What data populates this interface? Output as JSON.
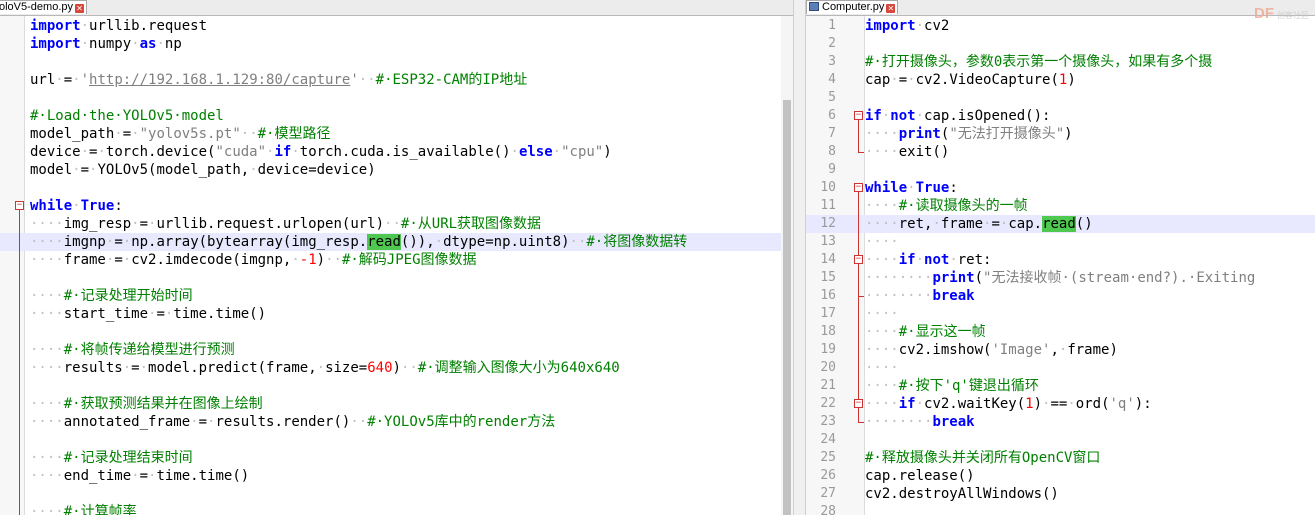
{
  "left_editor": {
    "tab": {
      "title": "oloV5-demo.py"
    },
    "lines": [
      {
        "num": "",
        "segs": [
          [
            "k",
            "import"
          ],
          [
            "ws",
            "·"
          ],
          [
            "t",
            "urllib.request"
          ]
        ]
      },
      {
        "num": "",
        "segs": [
          [
            "k",
            "import"
          ],
          [
            "ws",
            "·"
          ],
          [
            "t",
            "numpy"
          ],
          [
            "ws",
            "·"
          ],
          [
            "k",
            "as"
          ],
          [
            "ws",
            "·"
          ],
          [
            "t",
            "np"
          ]
        ]
      },
      {
        "num": "",
        "segs": []
      },
      {
        "num": "",
        "segs": [
          [
            "t",
            "url"
          ],
          [
            "ws",
            "·"
          ],
          [
            "t",
            "="
          ],
          [
            "ws",
            "·"
          ],
          [
            "s",
            "'"
          ],
          [
            "u",
            "http://192.168.1.129:80/capture"
          ],
          [
            "s",
            "'"
          ],
          [
            "ws",
            "··"
          ],
          [
            "c",
            "#·ESP32-CAM的IP地址"
          ]
        ]
      },
      {
        "num": "",
        "segs": []
      },
      {
        "num": "",
        "segs": [
          [
            "c",
            "#·Load·the·YOLOv5·model"
          ]
        ]
      },
      {
        "num": "",
        "segs": [
          [
            "t",
            "model_path"
          ],
          [
            "ws",
            "·"
          ],
          [
            "t",
            "="
          ],
          [
            "ws",
            "·"
          ],
          [
            "s",
            "\"yolov5s.pt\""
          ],
          [
            "ws",
            "··"
          ],
          [
            "c",
            "#·模型路径"
          ]
        ]
      },
      {
        "num": "",
        "segs": [
          [
            "t",
            "device"
          ],
          [
            "ws",
            "·"
          ],
          [
            "t",
            "="
          ],
          [
            "ws",
            "·"
          ],
          [
            "t",
            "torch.device("
          ],
          [
            "s",
            "\"cuda\""
          ],
          [
            "ws",
            "·"
          ],
          [
            "k",
            "if"
          ],
          [
            "ws",
            "·"
          ],
          [
            "t",
            "torch.cuda.is_available()"
          ],
          [
            "ws",
            "·"
          ],
          [
            "k",
            "else"
          ],
          [
            "ws",
            "·"
          ],
          [
            "s",
            "\"cpu\""
          ],
          [
            "t",
            ")"
          ]
        ]
      },
      {
        "num": "",
        "segs": [
          [
            "t",
            "model"
          ],
          [
            "ws",
            "·"
          ],
          [
            "t",
            "="
          ],
          [
            "ws",
            "·"
          ],
          [
            "t",
            "YOLOv5(model_path,"
          ],
          [
            "ws",
            "·"
          ],
          [
            "t",
            "device=device)"
          ]
        ]
      },
      {
        "num": "",
        "segs": []
      },
      {
        "num": "",
        "segs": [
          [
            "k",
            "while"
          ],
          [
            "ws",
            "·"
          ],
          [
            "k",
            "True"
          ],
          [
            "t",
            ":"
          ]
        ]
      },
      {
        "num": "",
        "segs": [
          [
            "ws",
            "····"
          ],
          [
            "t",
            "img_resp"
          ],
          [
            "ws",
            "·"
          ],
          [
            "t",
            "="
          ],
          [
            "ws",
            "·"
          ],
          [
            "t",
            "urllib.request.urlopen(url)"
          ],
          [
            "ws",
            "··"
          ],
          [
            "c",
            "#·从URL获取图像数据"
          ]
        ]
      },
      {
        "num": "",
        "hl": true,
        "segs": [
          [
            "ws",
            "····"
          ],
          [
            "t",
            "imgnp"
          ],
          [
            "ws",
            "·"
          ],
          [
            "t",
            "="
          ],
          [
            "ws",
            "·"
          ],
          [
            "t",
            "np.array(bytearray(img_resp."
          ],
          [
            "m",
            "read"
          ],
          [
            "t",
            "()),"
          ],
          [
            "ws",
            "·"
          ],
          [
            "t",
            "dtype=np.uint8)"
          ],
          [
            "ws",
            "··"
          ],
          [
            "c",
            "#·将图像数据转"
          ]
        ]
      },
      {
        "num": "",
        "segs": [
          [
            "ws",
            "····"
          ],
          [
            "t",
            "frame"
          ],
          [
            "ws",
            "·"
          ],
          [
            "t",
            "="
          ],
          [
            "ws",
            "·"
          ],
          [
            "t",
            "cv2.imdecode(imgnp,"
          ],
          [
            "ws",
            "·"
          ],
          [
            "n",
            "-1"
          ],
          [
            "t",
            ")"
          ],
          [
            "ws",
            "··"
          ],
          [
            "c",
            "#·解码JPEG图像数据"
          ]
        ]
      },
      {
        "num": "",
        "segs": []
      },
      {
        "num": "",
        "segs": [
          [
            "ws",
            "····"
          ],
          [
            "c",
            "#·记录处理开始时间"
          ]
        ]
      },
      {
        "num": "",
        "segs": [
          [
            "ws",
            "····"
          ],
          [
            "t",
            "start_time"
          ],
          [
            "ws",
            "·"
          ],
          [
            "t",
            "="
          ],
          [
            "ws",
            "·"
          ],
          [
            "t",
            "time.time()"
          ]
        ]
      },
      {
        "num": "",
        "segs": []
      },
      {
        "num": "",
        "segs": [
          [
            "ws",
            "····"
          ],
          [
            "c",
            "#·将帧传递给模型进行预测"
          ]
        ]
      },
      {
        "num": "",
        "segs": [
          [
            "ws",
            "····"
          ],
          [
            "t",
            "results"
          ],
          [
            "ws",
            "·"
          ],
          [
            "t",
            "="
          ],
          [
            "ws",
            "·"
          ],
          [
            "t",
            "model.predict(frame,"
          ],
          [
            "ws",
            "·"
          ],
          [
            "t",
            "size="
          ],
          [
            "n",
            "640"
          ],
          [
            "t",
            ")"
          ],
          [
            "ws",
            "··"
          ],
          [
            "c",
            "#·调整输入图像大小为640x640"
          ]
        ]
      },
      {
        "num": "",
        "segs": []
      },
      {
        "num": "",
        "segs": [
          [
            "ws",
            "····"
          ],
          [
            "c",
            "#·获取预测结果并在图像上绘制"
          ]
        ]
      },
      {
        "num": "",
        "segs": [
          [
            "ws",
            "····"
          ],
          [
            "t",
            "annotated_frame"
          ],
          [
            "ws",
            "·"
          ],
          [
            "t",
            "="
          ],
          [
            "ws",
            "·"
          ],
          [
            "t",
            "results.render()"
          ],
          [
            "ws",
            "··"
          ],
          [
            "c",
            "#·YOLOv5库中的render方法"
          ]
        ]
      },
      {
        "num": "",
        "segs": []
      },
      {
        "num": "",
        "segs": [
          [
            "ws",
            "····"
          ],
          [
            "c",
            "#·记录处理结束时间"
          ]
        ]
      },
      {
        "num": "",
        "segs": [
          [
            "ws",
            "····"
          ],
          [
            "t",
            "end_time"
          ],
          [
            "ws",
            "·"
          ],
          [
            "t",
            "="
          ],
          [
            "ws",
            "·"
          ],
          [
            "t",
            "time.time()"
          ]
        ]
      },
      {
        "num": "",
        "segs": []
      },
      {
        "num": "",
        "segs": [
          [
            "ws",
            "····"
          ],
          [
            "c",
            "#·计算帧率"
          ]
        ]
      }
    ]
  },
  "right_editor": {
    "tab": {
      "title": "Computer.py"
    },
    "lines": [
      {
        "num": "1",
        "segs": [
          [
            "k",
            "import"
          ],
          [
            "ws",
            "·"
          ],
          [
            "t",
            "cv2"
          ]
        ]
      },
      {
        "num": "2",
        "segs": []
      },
      {
        "num": "3",
        "segs": [
          [
            "c",
            "#·打开摄像头，参数0表示第一个摄像头，如果有多个摄"
          ]
        ]
      },
      {
        "num": "4",
        "segs": [
          [
            "t",
            "cap"
          ],
          [
            "ws",
            "·"
          ],
          [
            "t",
            "="
          ],
          [
            "ws",
            "·"
          ],
          [
            "t",
            "cv2.VideoCapture("
          ],
          [
            "n",
            "1"
          ],
          [
            "t",
            ")"
          ]
        ]
      },
      {
        "num": "5",
        "segs": []
      },
      {
        "num": "6",
        "segs": [
          [
            "k",
            "if"
          ],
          [
            "ws",
            "·"
          ],
          [
            "k",
            "not"
          ],
          [
            "ws",
            "·"
          ],
          [
            "t",
            "cap.isOpened():"
          ]
        ]
      },
      {
        "num": "7",
        "segs": [
          [
            "ws",
            "····"
          ],
          [
            "k",
            "print"
          ],
          [
            "t",
            "("
          ],
          [
            "s",
            "\"无法打开摄像头\""
          ],
          [
            "t",
            ")"
          ]
        ]
      },
      {
        "num": "8",
        "segs": [
          [
            "ws",
            "····"
          ],
          [
            "t",
            "exit()"
          ]
        ]
      },
      {
        "num": "9",
        "segs": []
      },
      {
        "num": "10",
        "segs": [
          [
            "k",
            "while"
          ],
          [
            "ws",
            "·"
          ],
          [
            "k",
            "True"
          ],
          [
            "t",
            ":"
          ]
        ]
      },
      {
        "num": "11",
        "segs": [
          [
            "ws",
            "····"
          ],
          [
            "c",
            "#·读取摄像头的一帧"
          ]
        ]
      },
      {
        "num": "12",
        "hl": true,
        "segs": [
          [
            "ws",
            "····"
          ],
          [
            "t",
            "ret,"
          ],
          [
            "ws",
            "·"
          ],
          [
            "t",
            "frame"
          ],
          [
            "ws",
            "·"
          ],
          [
            "t",
            "="
          ],
          [
            "ws",
            "·"
          ],
          [
            "t",
            "cap."
          ],
          [
            "m",
            "read"
          ],
          [
            "t",
            "()"
          ]
        ]
      },
      {
        "num": "13",
        "segs": [
          [
            "ws",
            "····"
          ]
        ]
      },
      {
        "num": "14",
        "segs": [
          [
            "ws",
            "····"
          ],
          [
            "k",
            "if"
          ],
          [
            "ws",
            "·"
          ],
          [
            "k",
            "not"
          ],
          [
            "ws",
            "·"
          ],
          [
            "t",
            "ret:"
          ]
        ]
      },
      {
        "num": "15",
        "segs": [
          [
            "ws",
            "········"
          ],
          [
            "k",
            "print"
          ],
          [
            "t",
            "("
          ],
          [
            "s",
            "\"无法接收帧·(stream·end?).·Exiting"
          ]
        ]
      },
      {
        "num": "16",
        "segs": [
          [
            "ws",
            "········"
          ],
          [
            "k",
            "break"
          ]
        ]
      },
      {
        "num": "17",
        "segs": [
          [
            "ws",
            "····"
          ]
        ]
      },
      {
        "num": "18",
        "segs": [
          [
            "ws",
            "····"
          ],
          [
            "c",
            "#·显示这一帧"
          ]
        ]
      },
      {
        "num": "19",
        "segs": [
          [
            "ws",
            "····"
          ],
          [
            "t",
            "cv2.imshow("
          ],
          [
            "s",
            "'Image'"
          ],
          [
            "t",
            ","
          ],
          [
            "ws",
            "·"
          ],
          [
            "t",
            "frame)"
          ]
        ]
      },
      {
        "num": "20",
        "segs": [
          [
            "ws",
            "····"
          ]
        ]
      },
      {
        "num": "21",
        "segs": [
          [
            "ws",
            "····"
          ],
          [
            "c",
            "#·按下'q'键退出循环"
          ]
        ]
      },
      {
        "num": "22",
        "segs": [
          [
            "ws",
            "····"
          ],
          [
            "k",
            "if"
          ],
          [
            "ws",
            "·"
          ],
          [
            "t",
            "cv2.waitKey("
          ],
          [
            "n",
            "1"
          ],
          [
            "t",
            ")"
          ],
          [
            "ws",
            "·"
          ],
          [
            "t",
            "=="
          ],
          [
            "ws",
            "·"
          ],
          [
            "t",
            "ord("
          ],
          [
            "s",
            "'q'"
          ],
          [
            "t",
            "):"
          ]
        ]
      },
      {
        "num": "23",
        "segs": [
          [
            "ws",
            "········"
          ],
          [
            "k",
            "break"
          ]
        ]
      },
      {
        "num": "24",
        "segs": []
      },
      {
        "num": "25",
        "segs": [
          [
            "c",
            "#·释放摄像头并关闭所有OpenCV窗口"
          ]
        ]
      },
      {
        "num": "26",
        "segs": [
          [
            "t",
            "cap.release()"
          ]
        ]
      },
      {
        "num": "27",
        "segs": [
          [
            "t",
            "cv2.destroyAllWindows()"
          ]
        ]
      },
      {
        "num": "28",
        "segs": []
      }
    ]
  },
  "watermark": {
    "brand": "DF",
    "sub": "创客社区"
  }
}
